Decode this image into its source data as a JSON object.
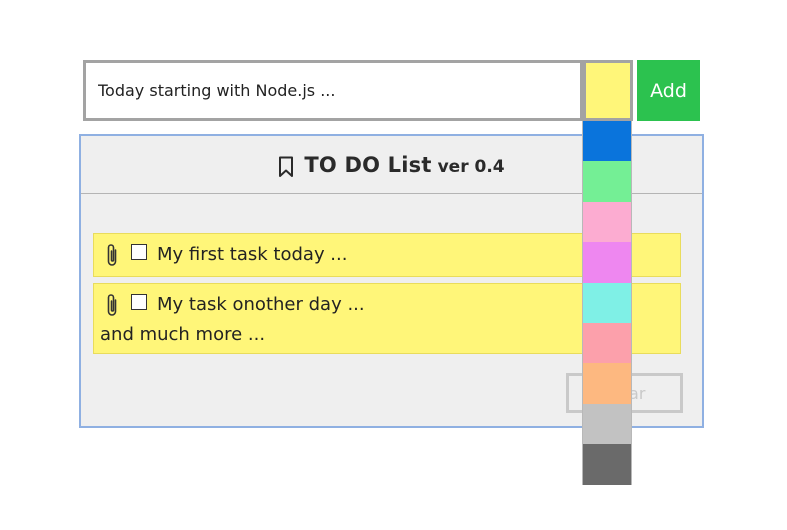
{
  "input": {
    "value": "Today starting with Node.js ..."
  },
  "color_picker": {
    "selected": "#fff679",
    "options": [
      "#0a74dc",
      "#74ef95",
      "#fcacd1",
      "#ee87f0",
      "#7ff0e6",
      "#fca0ab",
      "#fdb880",
      "#c2c2c2",
      "#6a6a6a"
    ]
  },
  "toolbar": {
    "add_label": "Add"
  },
  "panel": {
    "title": "TO DO List",
    "version": "ver 0.4",
    "icon": "bookmark-icon",
    "clear_label": "Clear"
  },
  "tasks": [
    {
      "text": "My first task today ...",
      "continuation": "",
      "color": "#fff679",
      "checked": false,
      "icon": "paperclip-icon"
    },
    {
      "text": "My task onother day ...",
      "continuation": "and much more ...",
      "color": "#fff679",
      "checked": false,
      "icon": "paperclip-icon"
    }
  ],
  "colors": {
    "add_button": "#2cc24f",
    "panel_border": "#8fb0e2",
    "panel_bg": "#efefef"
  }
}
